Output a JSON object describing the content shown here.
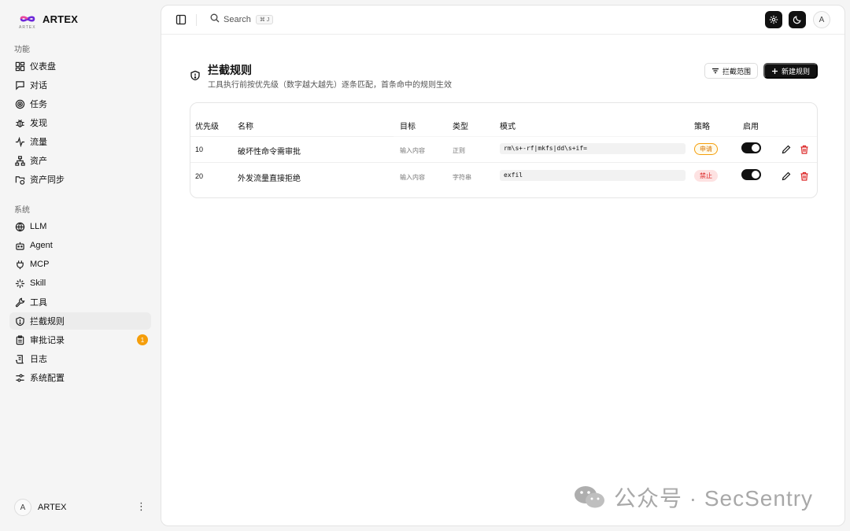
{
  "brand": {
    "name": "ARTEX",
    "small": "ARTEX"
  },
  "sidebar": {
    "section_features": "功能",
    "features": [
      {
        "label": "仪表盘",
        "icon": "dashboard-icon"
      },
      {
        "label": "对话",
        "icon": "chat-icon"
      },
      {
        "label": "任务",
        "icon": "target-icon"
      },
      {
        "label": "发现",
        "icon": "bug-icon"
      },
      {
        "label": "流量",
        "icon": "activity-icon"
      },
      {
        "label": "资产",
        "icon": "network-icon"
      },
      {
        "label": "资产同步",
        "icon": "folder-sync-icon"
      }
    ],
    "section_system": "系统",
    "system": [
      {
        "label": "LLM",
        "icon": "globe-icon"
      },
      {
        "label": "Agent",
        "icon": "bot-icon"
      },
      {
        "label": "MCP",
        "icon": "plug-icon"
      },
      {
        "label": "Skill",
        "icon": "sparkle-icon"
      },
      {
        "label": "工具",
        "icon": "wrench-icon"
      },
      {
        "label": "拦截规则",
        "icon": "shield-icon",
        "active": true
      },
      {
        "label": "审批记录",
        "icon": "clipboard-icon",
        "badge": "1"
      },
      {
        "label": "日志",
        "icon": "scroll-icon"
      },
      {
        "label": "系统配置",
        "icon": "settings-sliders-icon"
      }
    ],
    "user": {
      "avatar": "A",
      "name": "ARTEX",
      "more": "⋮"
    }
  },
  "topbar": {
    "search_label": "Search",
    "shortcut": "⌘ J",
    "avatar": "A"
  },
  "page": {
    "title": "拦截规则",
    "subtitle": "工具执行前按优先级（数字越大越先）逐条匹配，首条命中的规则生效",
    "scope_button": "拦截范围",
    "new_button": "新建规则"
  },
  "table": {
    "columns": {
      "priority": "优先级",
      "name": "名称",
      "target": "目标",
      "type": "类型",
      "pattern": "模式",
      "policy": "策略",
      "enabled": "启用"
    },
    "rows": [
      {
        "priority": "10",
        "name": "破坏性命令需审批",
        "target": "输入内容",
        "type": "正则",
        "pattern": "rm\\s+-rf|mkfs|dd\\s+if=",
        "policy": "申请",
        "policy_kind": "apply",
        "enabled": true
      },
      {
        "priority": "20",
        "name": "外发流量直接拒绝",
        "target": "输入内容",
        "type": "字符串",
        "pattern": "exfil",
        "policy": "禁止",
        "policy_kind": "deny",
        "enabled": true
      }
    ]
  },
  "watermark": {
    "text": "公众号 · SecSentry"
  },
  "colors": {
    "badge": "#f59e0b",
    "danger": "#dc2626",
    "apply": "#d97706",
    "dark": "#111111"
  }
}
